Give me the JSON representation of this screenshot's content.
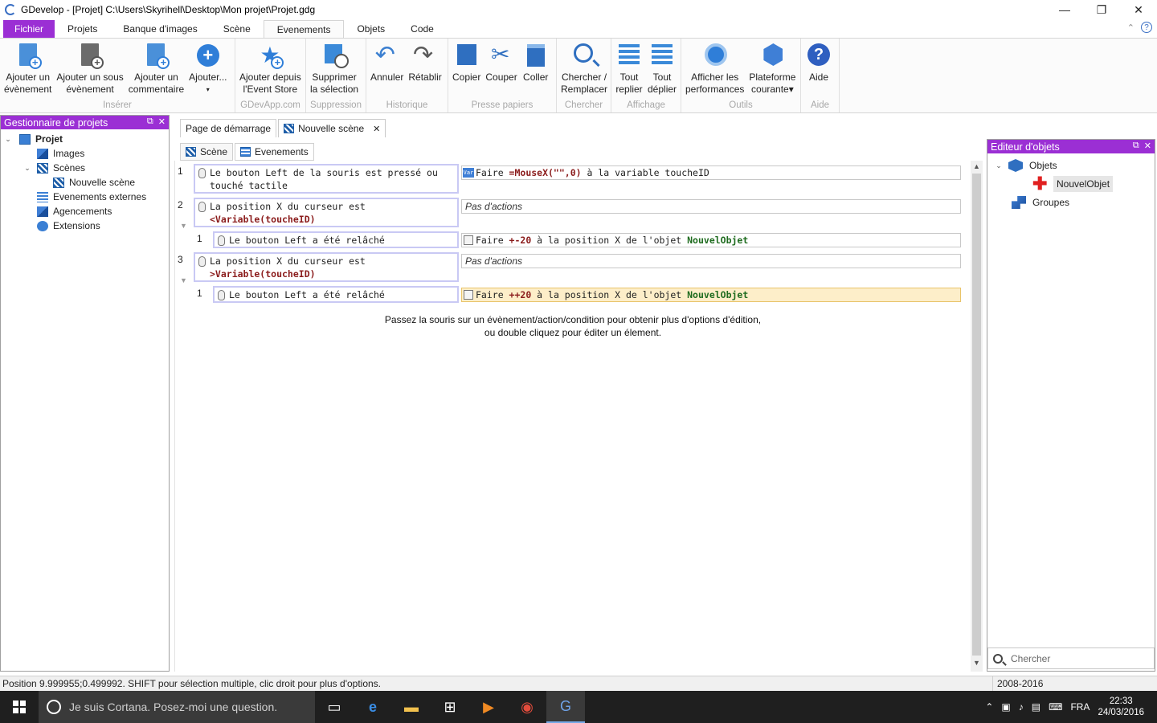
{
  "window": {
    "title": "GDevelop - [Projet] C:\\Users\\Skyrihell\\Desktop\\Mon projet\\Projet.gdg",
    "minimize": "—",
    "maximize": "❐",
    "close": "✕"
  },
  "ribbon_tabs": [
    {
      "label": "Fichier"
    },
    {
      "label": "Projets"
    },
    {
      "label": "Banque d'images"
    },
    {
      "label": "Scène"
    },
    {
      "label": "Evenements"
    },
    {
      "label": "Objets"
    },
    {
      "label": "Code"
    }
  ],
  "ribbon_tabs_right": {
    "collapse": "⌃",
    "help": "?"
  },
  "ribbon": {
    "groups": [
      {
        "label": "Insérer",
        "buttons": [
          {
            "line1": "Ajouter un",
            "line2": "évènement"
          },
          {
            "line1": "Ajouter un sous",
            "line2": "évènement"
          },
          {
            "line1": "Ajouter un",
            "line2": "commentaire"
          },
          {
            "line1": "Ajouter...",
            "line2": "▾"
          }
        ]
      },
      {
        "label": "GDevApp.com",
        "buttons": [
          {
            "line1": "Ajouter depuis",
            "line2": "l'Event Store"
          }
        ]
      },
      {
        "label": "Suppression",
        "buttons": [
          {
            "line1": "Supprimer",
            "line2": "la sélection"
          }
        ]
      },
      {
        "label": "Historique",
        "buttons": [
          {
            "line1": "Annuler",
            "line2": ""
          },
          {
            "line1": "Rétablir",
            "line2": ""
          }
        ]
      },
      {
        "label": "Presse papiers",
        "buttons": [
          {
            "line1": "Copier",
            "line2": ""
          },
          {
            "line1": "Couper",
            "line2": ""
          },
          {
            "line1": "Coller",
            "line2": ""
          }
        ]
      },
      {
        "label": "Chercher",
        "buttons": [
          {
            "line1": "Chercher /",
            "line2": "Remplacer"
          }
        ]
      },
      {
        "label": "Affichage",
        "buttons": [
          {
            "line1": "Tout",
            "line2": "replier"
          },
          {
            "line1": "Tout",
            "line2": "déplier"
          }
        ]
      },
      {
        "label": "Outils",
        "buttons": [
          {
            "line1": "Afficher les",
            "line2": "performances"
          },
          {
            "line1": "Plateforme",
            "line2": "courante▾"
          }
        ]
      },
      {
        "label": "Aide",
        "buttons": [
          {
            "line1": "Aide",
            "line2": ""
          }
        ]
      }
    ]
  },
  "left_panel": {
    "title": "Gestionnaire de projets",
    "float": "⧉",
    "close": "✕",
    "tree": [
      {
        "label": "Projet",
        "expander": "⌄"
      },
      {
        "label": "Images"
      },
      {
        "label": "Scènes",
        "expander": "⌄"
      },
      {
        "label": "Nouvelle scène"
      },
      {
        "label": "Evenements externes"
      },
      {
        "label": "Agencements"
      },
      {
        "label": "Extensions"
      }
    ]
  },
  "doc_tabs": [
    {
      "label": "Page de démarrage"
    },
    {
      "label": "Nouvelle scène",
      "close": "✕"
    }
  ],
  "sub_tabs": [
    {
      "label": "Scène"
    },
    {
      "label": "Evenements"
    }
  ],
  "events": {
    "e1": {
      "num": "1",
      "cond": "Le bouton Left de la souris est pressé ou touché tactile",
      "act_pre": "Faire ",
      "act_val": "=MouseX(\"\",0)",
      "act_mid": " à la variable ",
      "act_var": "toucheID",
      "var_icon": "Var"
    },
    "e2": {
      "num": "2",
      "cond_pre": "La position X du curseur est ",
      "cond_val": "<Variable(toucheID)",
      "noact": "Pas d'actions",
      "sub": {
        "num": "1",
        "cond": "Le bouton Left a été relâché",
        "act_pre": "Faire ",
        "act_val": "+-20",
        "act_mid": " à la position X de l'objet ",
        "act_obj": "NouvelObjet"
      }
    },
    "e3": {
      "num": "3",
      "cond_pre": "La position X du curseur est ",
      "cond_val": ">Variable(toucheID)",
      "noact": "Pas d'actions",
      "sub": {
        "num": "1",
        "cond": "Le bouton Left a été relâché",
        "act_pre": "Faire ",
        "act_val": "++20",
        "act_mid": " à la position X de l'objet ",
        "act_obj": "NouvelObjet"
      }
    },
    "hint1": "Passez la souris sur un évènement/action/condition pour obtenir plus d'options d'édition,",
    "hint2": "ou double cliquez pour éditer un élement."
  },
  "right_panel": {
    "title": "Editeur d'objets",
    "float": "⧉",
    "close": "✕",
    "objects": "Objets",
    "object_item": "NouvelObjet",
    "groups": "Groupes",
    "search_placeholder": "Chercher"
  },
  "status": {
    "left": "Position 9.999955;0.499992. SHIFT pour sélection multiple, clic droit pour plus d'options.",
    "right": "2008-2016"
  },
  "taskbar": {
    "cortana": "Je suis Cortana. Posez-moi une question.",
    "lang": "FRA",
    "time": "22:33",
    "date": "24/03/2016"
  },
  "colors": {
    "accent": "#9b2fd4",
    "highlight": "#fdeec9"
  }
}
